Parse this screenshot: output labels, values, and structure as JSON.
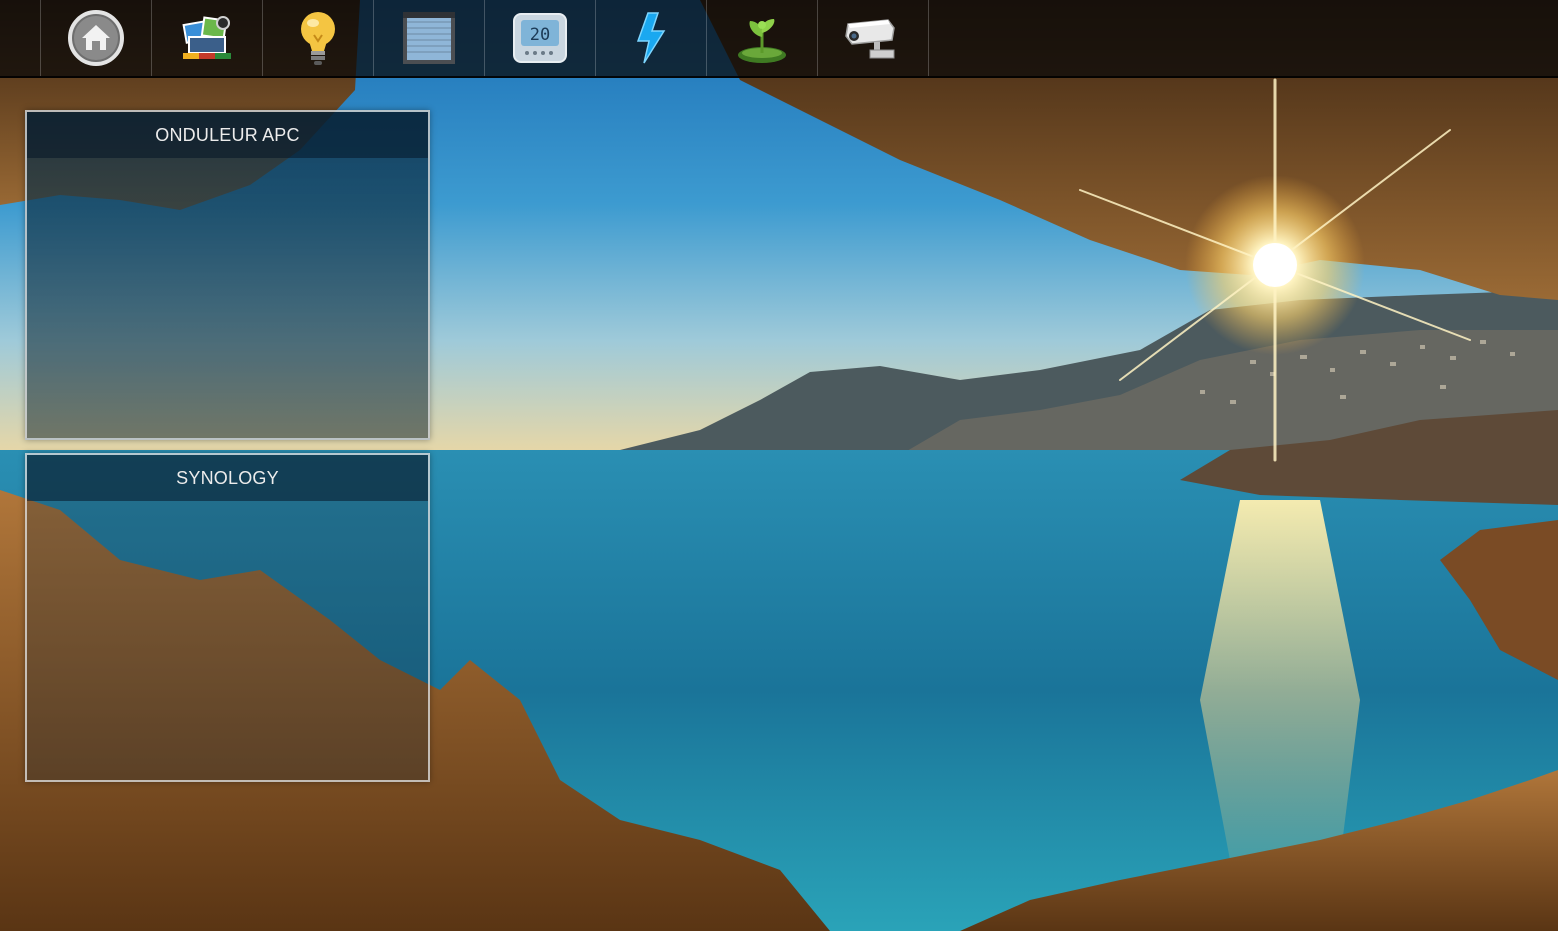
{
  "colors": {
    "topbar_bg": "#141414",
    "widget_header_text": "#ececec",
    "widget_border": "#e6e6e6",
    "sea": "#1f7fa6",
    "rock": "#8a5a2a"
  },
  "nav": {
    "items": [
      {
        "name": "home",
        "icon": "home-icon"
      },
      {
        "name": "scenes",
        "icon": "scenes-icon"
      },
      {
        "name": "lights",
        "icon": "lightbulb-icon"
      },
      {
        "name": "shutters",
        "icon": "shutter-icon"
      },
      {
        "name": "thermostat",
        "icon": "thermostat-icon",
        "display": "20"
      },
      {
        "name": "energy",
        "icon": "lightning-icon"
      },
      {
        "name": "garden",
        "icon": "plant-icon"
      },
      {
        "name": "camera",
        "icon": "cctv-camera-icon"
      }
    ]
  },
  "widgets": [
    {
      "title": "ONDULEUR APC"
    },
    {
      "title": "SYNOLOGY"
    }
  ]
}
